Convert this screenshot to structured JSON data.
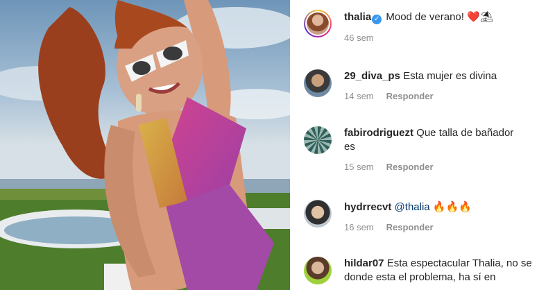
{
  "post": {
    "author": "thalia",
    "caption": "Mood de verano!",
    "caption_emojis": [
      "❤️",
      "⛱"
    ],
    "time": "46 sem",
    "verified": true
  },
  "comments": [
    {
      "username": "29_diva_ps",
      "text": "Esta mujer es divina",
      "time": "14 sem",
      "reply_label": "Responder"
    },
    {
      "username": "fabirodriguezt",
      "text": "Que talla de bañador es",
      "time": "15 sem",
      "reply_label": "Responder"
    },
    {
      "username": "hydrrecvt",
      "mention": "@thalia",
      "emojis": "🔥🔥🔥",
      "time": "16 sem",
      "reply_label": "Responder"
    },
    {
      "username": "hildar07",
      "text": "Esta espectacular Thalia, no se donde esta el problema, ha sí en"
    }
  ],
  "colors": {
    "verified_blue": "#3897f0",
    "mention_blue": "#00376b",
    "muted": "#8e8e8e",
    "heart": "#ed1c24"
  },
  "icons": [
    "verified-badge-icon",
    "heart-emoji",
    "beach-umbrella-emoji",
    "fire-emoji"
  ]
}
